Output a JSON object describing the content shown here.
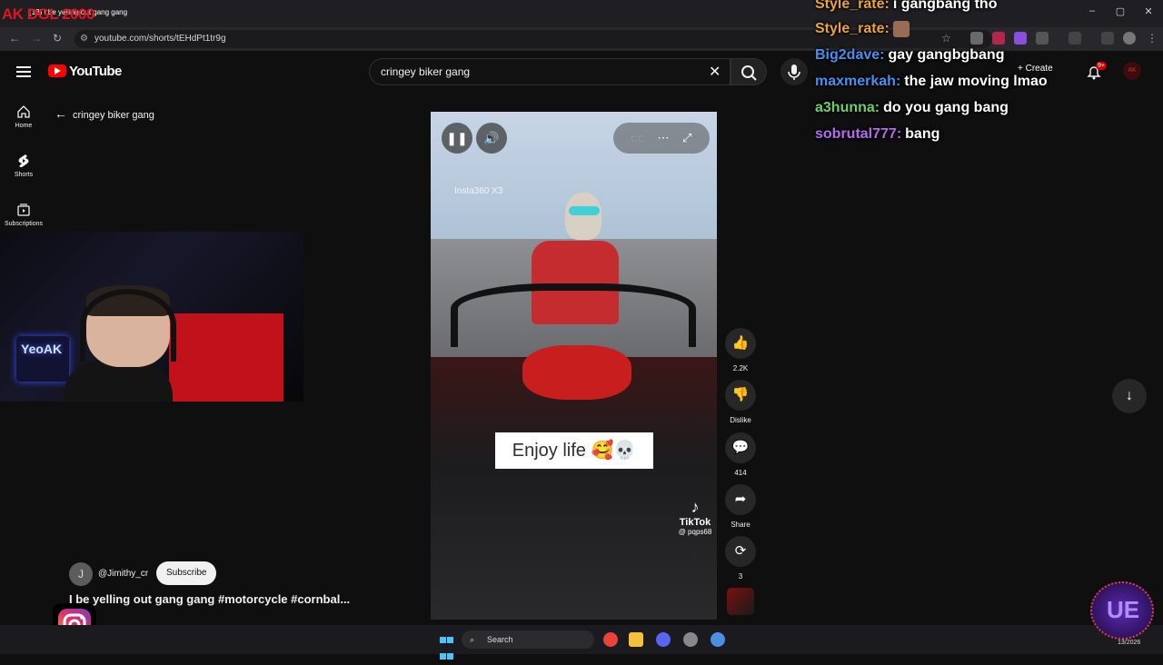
{
  "browser": {
    "overlay_title": "AK DGL 2000",
    "tab_title": "(13) I be yelling out gang gang",
    "url": "youtube.com/shorts/tEHdPt1tr9g"
  },
  "youtube": {
    "logo": "YouTube",
    "search_query": "cringey biker gang",
    "create_label": "Create",
    "notification_badge": "9+",
    "account_initials": "AK"
  },
  "sidebar": {
    "items": [
      {
        "label": "Home",
        "icon": "home-icon"
      },
      {
        "label": "Shorts",
        "icon": "shorts-icon"
      },
      {
        "label": "Subscriptions",
        "icon": "subscriptions-icon"
      }
    ],
    "back_label": "cringey biker gang"
  },
  "webcam": {
    "neon_sign": "YeoAK"
  },
  "video": {
    "watermark": "Insta360 X3",
    "caption": "Enjoy life 🥰💀",
    "tiktok_label": "TikTok",
    "tiktok_user": "@ pqps68"
  },
  "channel": {
    "avatar_letter": "J",
    "name": "@Jimithy_cr",
    "subscribe_label": "Subscribe",
    "title": "I be yelling out gang gang #motorcycle #cornbal..."
  },
  "actions": {
    "likes": "2.2K",
    "dislike_label": "Dislike",
    "comments": "414",
    "share_label": "Share",
    "remix": "3"
  },
  "chat": [
    {
      "user": "Style_rate:",
      "message": "i gangbang tho",
      "color": "#e8a33c"
    },
    {
      "user": "Style_rate:",
      "message": "",
      "color": "#e8a33c"
    },
    {
      "user": "Big2dave:",
      "message": "gay gangbgbang",
      "color": "#4a8ff0"
    },
    {
      "user": "maxmerkah:",
      "message": "the jaw moving lmao",
      "color": "#4a8ff0"
    },
    {
      "user": "a3hunna:",
      "message": "do you gang bang",
      "color": "#6fd06a"
    },
    {
      "user": "sobrutal777:",
      "message": "bang",
      "color": "#b36cf0"
    }
  ],
  "taskbar": {
    "search_placeholder": "Search",
    "date": "13/2026"
  },
  "colors": {
    "youtube_red": "#ff0000",
    "background": "#0f0f0f",
    "overlay_red": "#e0141e"
  }
}
